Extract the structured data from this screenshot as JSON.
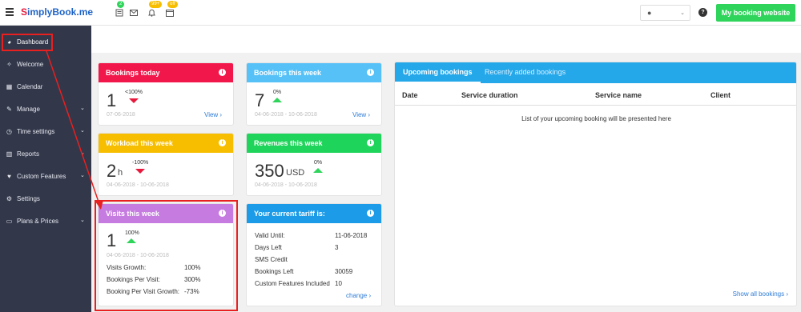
{
  "topbar": {
    "logo_initial": "S",
    "logo_text": "implyBook.me",
    "badges": {
      "list": "2",
      "bell": "99+",
      "calendar": "off"
    },
    "help": "?",
    "my_booking": "My booking website"
  },
  "sidebar": {
    "items": [
      {
        "label": "Dashboard",
        "icon": "dashboard-icon",
        "glyph": "◕"
      },
      {
        "label": "Welcome",
        "icon": "lightbulb-icon",
        "glyph": "✧"
      },
      {
        "label": "Calendar",
        "icon": "calendar-icon",
        "glyph": "▦"
      },
      {
        "label": "Manage",
        "icon": "pencil-icon",
        "glyph": "✎",
        "chevron": "⌄"
      },
      {
        "label": "Time settings",
        "icon": "clock-icon",
        "glyph": "◷",
        "chevron": "⌄"
      },
      {
        "label": "Reports",
        "icon": "chart-icon",
        "glyph": "▥",
        "chevron": "⌄"
      },
      {
        "label": "Custom Features",
        "icon": "puzzle-icon",
        "glyph": "♥",
        "chevron": "⌄"
      },
      {
        "label": "Settings",
        "icon": "gears-icon",
        "glyph": "⚙"
      },
      {
        "label": "Plans & Prices",
        "icon": "card-icon",
        "glyph": "▭",
        "chevron": "⌄"
      }
    ]
  },
  "cards": {
    "bookings_today": {
      "title": "Bookings today",
      "value": "1",
      "pct": "<100%",
      "date": "07-06-2018",
      "link": "View  ›",
      "color": "#f2174a"
    },
    "bookings_week": {
      "title": "Bookings this week",
      "value": "7",
      "pct": "0%",
      "date": "04-06-2018 - 10-06-2018",
      "link": "View  ›",
      "color": "#56c1f7"
    },
    "workload": {
      "title": "Workload this week",
      "value": "2",
      "unit": "h",
      "pct": "-100%",
      "date": "04-06-2018 - 10-06-2018",
      "color": "#f7be00"
    },
    "revenues": {
      "title": "Revenues this week",
      "value": "350",
      "unit": "USD",
      "pct": "0%",
      "date": "04-06-2018 - 10-06-2018",
      "color": "#1fd45a"
    },
    "visits": {
      "title": "Visits this week",
      "value": "1",
      "pct": "100%",
      "date": "04-06-2018 - 10-06-2018",
      "color": "#c67be0",
      "rows": [
        {
          "label": "Visits Growth:",
          "value": "100%"
        },
        {
          "label": "Bookings Per Visit:",
          "value": "300%"
        },
        {
          "label": "Booking Per Visit Growth:",
          "value": "-73%"
        }
      ]
    },
    "tariff": {
      "title": "Your current tariff is:",
      "color": "#1c9be8",
      "rows": [
        {
          "label": "Valid Until:",
          "value": "11-06-2018"
        },
        {
          "label": "Days Left",
          "value": "3"
        },
        {
          "label": "SMS Credit",
          "value": ""
        },
        {
          "label": "Bookings Left",
          "value": "30059"
        },
        {
          "label": "Custom Features Included",
          "value": "10"
        }
      ],
      "link": "change  ›"
    }
  },
  "upcoming": {
    "tabs": [
      "Upcoming bookings",
      "Recently added bookings"
    ],
    "columns": [
      "Date",
      "Service duration",
      "Service name",
      "Client"
    ],
    "empty_text": "List of your upcoming booking will be presented here",
    "show_all": "Show all bookings  ›"
  },
  "colors": {
    "sidebar": "#32374a",
    "annotation": "#e82020"
  }
}
